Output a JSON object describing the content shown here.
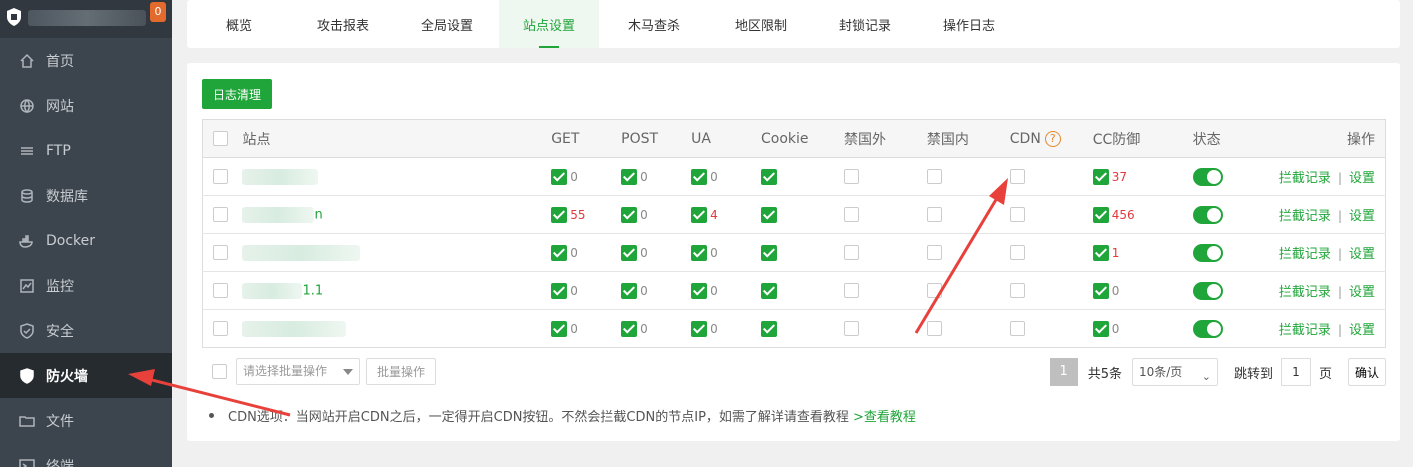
{
  "sidebar": {
    "logo_badge": "0",
    "items": [
      {
        "label": "首页",
        "icon": "home-icon",
        "active": false
      },
      {
        "label": "网站",
        "icon": "globe-icon",
        "active": false
      },
      {
        "label": "FTP",
        "icon": "ftp-icon",
        "active": false
      },
      {
        "label": "数据库",
        "icon": "database-icon",
        "active": false
      },
      {
        "label": "Docker",
        "icon": "docker-icon",
        "active": false
      },
      {
        "label": "监控",
        "icon": "monitor-icon",
        "active": false
      },
      {
        "label": "安全",
        "icon": "shield-check-icon",
        "active": false
      },
      {
        "label": "防火墙",
        "icon": "firewall-shield-icon",
        "active": true
      },
      {
        "label": "文件",
        "icon": "folder-icon",
        "active": false
      },
      {
        "label": "终端",
        "icon": "terminal-icon",
        "active": false
      }
    ]
  },
  "tabs": [
    "概览",
    "攻击报表",
    "全局设置",
    "站点设置",
    "木马查杀",
    "地区限制",
    "封锁记录",
    "操作日志"
  ],
  "active_tab": "站点设置",
  "clean_button": "日志清理",
  "table": {
    "headers": {
      "site": "站点",
      "get": "GET",
      "post": "POST",
      "ua": "UA",
      "cookie": "Cookie",
      "block_foreign": "禁国外",
      "block_domestic": "禁国内",
      "cdn": "CDN",
      "cdn_help": "?",
      "cc": "CC防御",
      "status": "状态",
      "ops": "操作"
    },
    "rows": [
      {
        "site_tail": "",
        "get": "0",
        "post": "0",
        "ua": "0",
        "cc": "37",
        "op_log": "拦截记录",
        "op_sep": "|",
        "op_set": "设置"
      },
      {
        "site_tail": "n",
        "get": "55",
        "post": "0",
        "ua": "4",
        "cc": "456",
        "op_log": "拦截记录",
        "op_sep": "|",
        "op_set": "设置"
      },
      {
        "site_tail": "",
        "get": "0",
        "post": "0",
        "ua": "0",
        "cc": "1",
        "op_log": "拦截记录",
        "op_sep": "|",
        "op_set": "设置"
      },
      {
        "site_tail": "1.1",
        "get": "0",
        "post": "0",
        "ua": "0",
        "cc": "0",
        "op_log": "拦截记录",
        "op_sep": "|",
        "op_set": "设置"
      },
      {
        "site_tail": "",
        "get": "0",
        "post": "0",
        "ua": "0",
        "cc": "0",
        "op_log": "拦截记录",
        "op_sep": "|",
        "op_set": "设置"
      }
    ]
  },
  "batch": {
    "placeholder": "请选择批量操作",
    "button": "批量操作"
  },
  "pager": {
    "current": "1",
    "total": "共5条",
    "page_size": "10条/页",
    "jump_label": "跳转到",
    "jump_value": "1",
    "page_unit": "页",
    "confirm": "确认"
  },
  "tip": {
    "text": "CDN选项：当网站开启CDN之后，一定得开启CDN按钮。不然会拦截CDN的节点IP，如需了解详请查看教程",
    "link": ">查看教程"
  },
  "colors": {
    "accent": "#20a53a",
    "danger": "#e4393c",
    "sidebar": "#3c444d",
    "annotation_arrow": "#e8403a"
  }
}
